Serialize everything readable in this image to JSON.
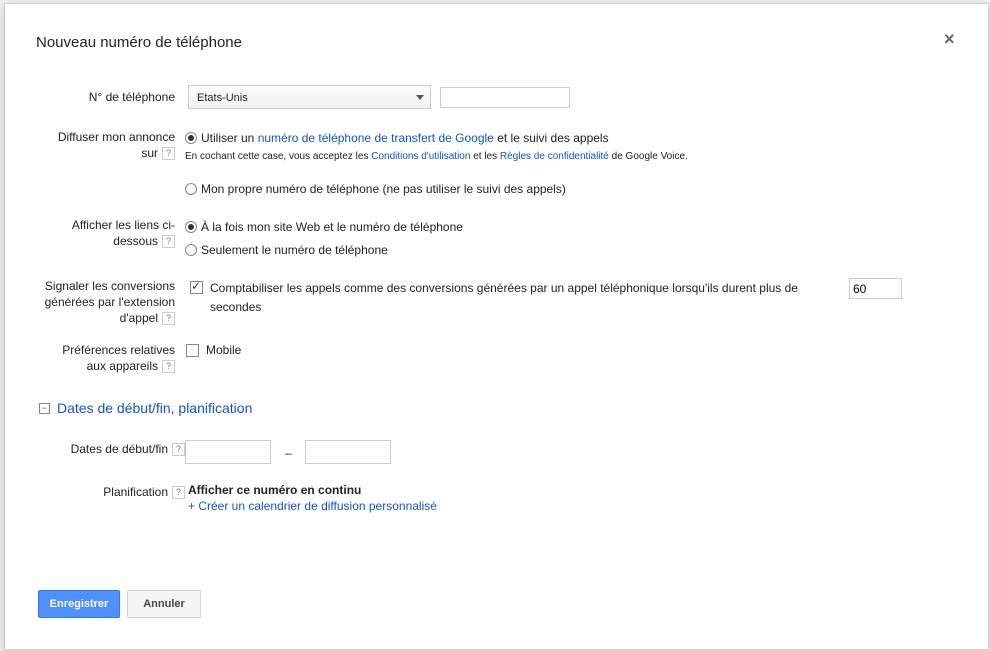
{
  "dialog": {
    "title": "Nouveau numéro de téléphone",
    "close_symbol": "×"
  },
  "phone": {
    "label": "N° de téléphone",
    "country_selected": "Etats-Unis",
    "number_value": ""
  },
  "diffuser": {
    "label_line1": "Diffuser mon annonce",
    "label_line2": "sur",
    "help": "?",
    "option1_prefix": "Utiliser un ",
    "option1_link": "numéro de téléphone de transfert de Google",
    "option1_suffix": " et le suivi des appels",
    "note_prefix": "En cochant cette case, vous acceptez les ",
    "note_link1": "Conditions d'utilisation",
    "note_mid": " et les ",
    "note_link2": "Règles de confidentialité",
    "note_suffix": " de Google Voice.",
    "option2": "Mon propre numéro de téléphone (ne pas utiliser le suivi des appels)"
  },
  "afficher": {
    "label_line1": "Afficher les liens ci-",
    "label_line2": "dessous",
    "help": "?",
    "option1": "À la fois mon site Web et le numéro de téléphone",
    "option2": "Seulement le numéro de téléphone"
  },
  "conversions": {
    "label_line1": "Signaler les conversions",
    "label_line2": "générées par l'extension",
    "label_line3": "d'appel",
    "help": "?",
    "checkbox_text_line1": "Comptabiliser les appels comme des conversions générées par un appel téléphonique lorsqu'ils durent plus de",
    "checkbox_text_line2": "secondes",
    "seconds_value": "60"
  },
  "devices": {
    "label_line1": "Préférences relatives",
    "label_line2": "aux appareils",
    "help": "?",
    "mobile_label": "Mobile"
  },
  "schedule_section": {
    "collapse_symbol": "−",
    "title": "Dates de début/fin, planification",
    "dates_label": "Dates de début/fin",
    "dates_help": "?",
    "date_separator": "–",
    "start_date": "",
    "end_date": "",
    "planning_label": "Planification",
    "planning_help": "?",
    "planning_value": "Afficher ce numéro en continu",
    "custom_schedule_link": "+ Créer un calendrier de diffusion personnalisé"
  },
  "buttons": {
    "save": "Enregistrer",
    "cancel": "Annuler"
  },
  "colors": {
    "link": "#1155cc",
    "primary": "#4d90fe"
  }
}
